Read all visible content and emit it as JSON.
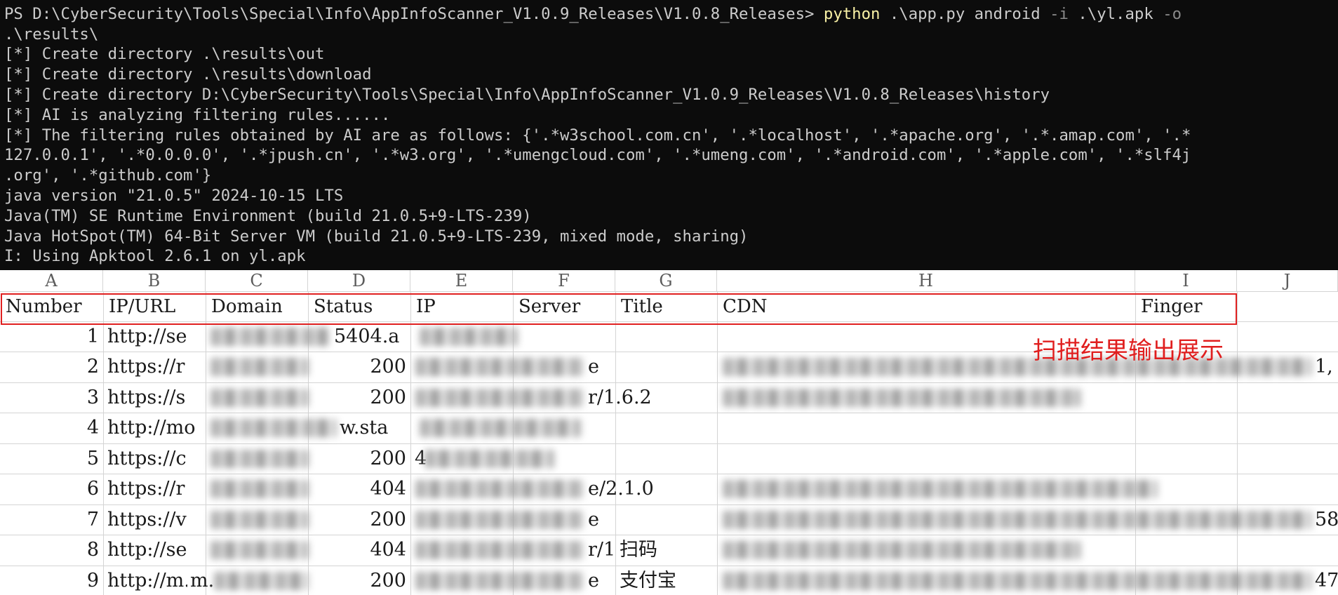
{
  "terminal": {
    "prompt": "PS D:\\CyberSecurity\\Tools\\Special\\Info\\AppInfoScanner_V1.0.9_Releases\\V1.0.8_Releases> ",
    "command": "python",
    "arg_script": " .\\app.py android ",
    "flag_i": "-i",
    "arg_apk": " .\\yl.apk ",
    "flag_o": "-o",
    "line2": ".\\results\\",
    "line3": "[*] Create directory .\\results\\out",
    "line4": "[*] Create directory .\\results\\download",
    "line5": "[*] Create directory D:\\CyberSecurity\\Tools\\Special\\Info\\AppInfoScanner_V1.0.9_Releases\\V1.0.8_Releases\\history",
    "line6": "[*] AI is analyzing filtering rules......",
    "line7": "[*] The filtering rules obtained by AI are as follows: {'.*w3school.com.cn', '.*localhost', '.*apache.org', '.*.amap.com', '.*",
    "line8": "127.0.0.1', '.*0.0.0.0', '.*jpush.cn', '.*w3.org', '.*umengcloud.com', '.*umeng.com', '.*android.com', '.*apple.com', '.*slf4j",
    "line9": ".org', '.*github.com'}",
    "line10": "java version \"21.0.5\" 2024-10-15 LTS",
    "line11": "Java(TM) SE Runtime Environment (build 21.0.5+9-LTS-239)",
    "line12": "Java HotSpot(TM) 64-Bit Server VM (build 21.0.5+9-LTS-239, mixed mode, sharing)",
    "line13": "I: Using Apktool 2.6.1 on yl.apk"
  },
  "sheet": {
    "column_letters": [
      "A",
      "B",
      "C",
      "D",
      "E",
      "F",
      "G",
      "H",
      "I",
      "J"
    ],
    "headers": {
      "number": "Number",
      "ip_url": "IP/URL",
      "domain": "Domain",
      "status": "Status",
      "ip": "IP",
      "server": "Server",
      "title": "Title",
      "cdn": "CDN",
      "finger": "Finger"
    },
    "rows": [
      {
        "number": "1",
        "url": "http://se",
        "status_text": "5404.a",
        "status": "",
        "server": "",
        "title": ""
      },
      {
        "number": "2",
        "url": "https://r",
        "status": "200",
        "server": "e",
        "title": ""
      },
      {
        "number": "3",
        "url": "https://s",
        "status": "200",
        "server": "r/1.6.2",
        "title": ""
      },
      {
        "number": "4",
        "url": "http://mo",
        "status_text": "w.sta",
        "status": "",
        "server": "",
        "title": ""
      },
      {
        "number": "5",
        "url": "https://c",
        "status": "200",
        "ip_prefix": "4",
        "server": "",
        "title": ""
      },
      {
        "number": "6",
        "url": "https://r",
        "status": "404",
        "server": "e/2.1.0",
        "title": ""
      },
      {
        "number": "7",
        "url": "https://v",
        "status": "200",
        "server": "e",
        "title": ""
      },
      {
        "number": "8",
        "url": "http://se",
        "status": "404",
        "server": "r/1",
        "title": "扫码"
      },
      {
        "number": "9",
        "url": "http://m.",
        "url_tail": "m.",
        "status": "200",
        "server": "e",
        "title": "支付宝"
      }
    ],
    "cdn_tail_row2": "1,",
    "cdn_tail_row7": "58",
    "cdn_tail_row9": "47"
  },
  "annotation": {
    "text": "扫描结果输出展示",
    "color": "#e01e1e"
  },
  "colors": {
    "terminal_bg": "#0c0c0c",
    "terminal_text": "#cccccc",
    "command_yellow": "#f9f1a5",
    "highlight_red": "#e02020"
  }
}
